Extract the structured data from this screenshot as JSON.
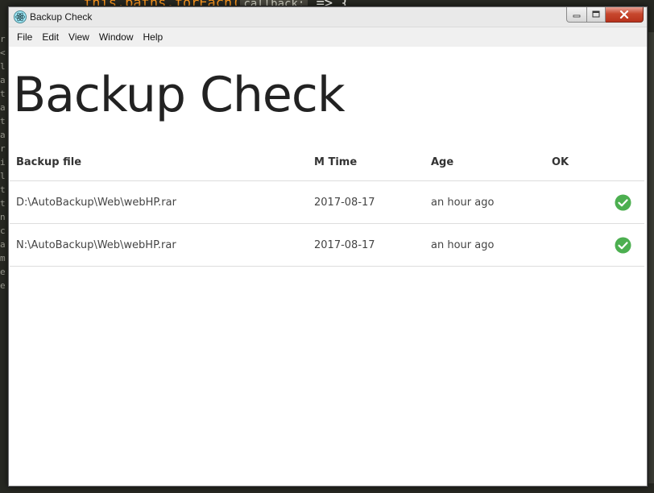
{
  "background_editor": {
    "top_code_prefix": "this.paths.forEach(",
    "top_code_pill": "callback:",
    "top_code_suffix": " => {",
    "gutter_chars": [
      "r",
      "<",
      "l",
      "a",
      "t",
      "a",
      "t",
      "a",
      "r",
      "i",
      "l",
      "t",
      "t",
      "n",
      "c",
      "a",
      "m",
      "e",
      "e"
    ]
  },
  "window": {
    "title": "Backup Check",
    "app_icon": "electron-atom-icon",
    "controls": [
      "minimize-icon",
      "maximize-icon",
      "close-icon"
    ]
  },
  "menu": {
    "items": [
      "File",
      "Edit",
      "View",
      "Window",
      "Help"
    ]
  },
  "page": {
    "title": "Backup Check"
  },
  "table": {
    "headers": {
      "file": "Backup file",
      "mtime": "M Time",
      "age": "Age",
      "ok": "OK"
    },
    "rows": [
      {
        "file": "D:\\AutoBackup\\Web\\webHP.rar",
        "mtime": "2017-08-17",
        "age": "an hour ago",
        "ok_icon": "check-circle-icon"
      },
      {
        "file": "N:\\AutoBackup\\Web\\webHP.rar",
        "mtime": "2017-08-17",
        "age": "an hour ago",
        "ok_icon": "check-circle-icon"
      }
    ]
  },
  "colors": {
    "ok_green": "#4caf50",
    "editor_bg": "#272822"
  }
}
